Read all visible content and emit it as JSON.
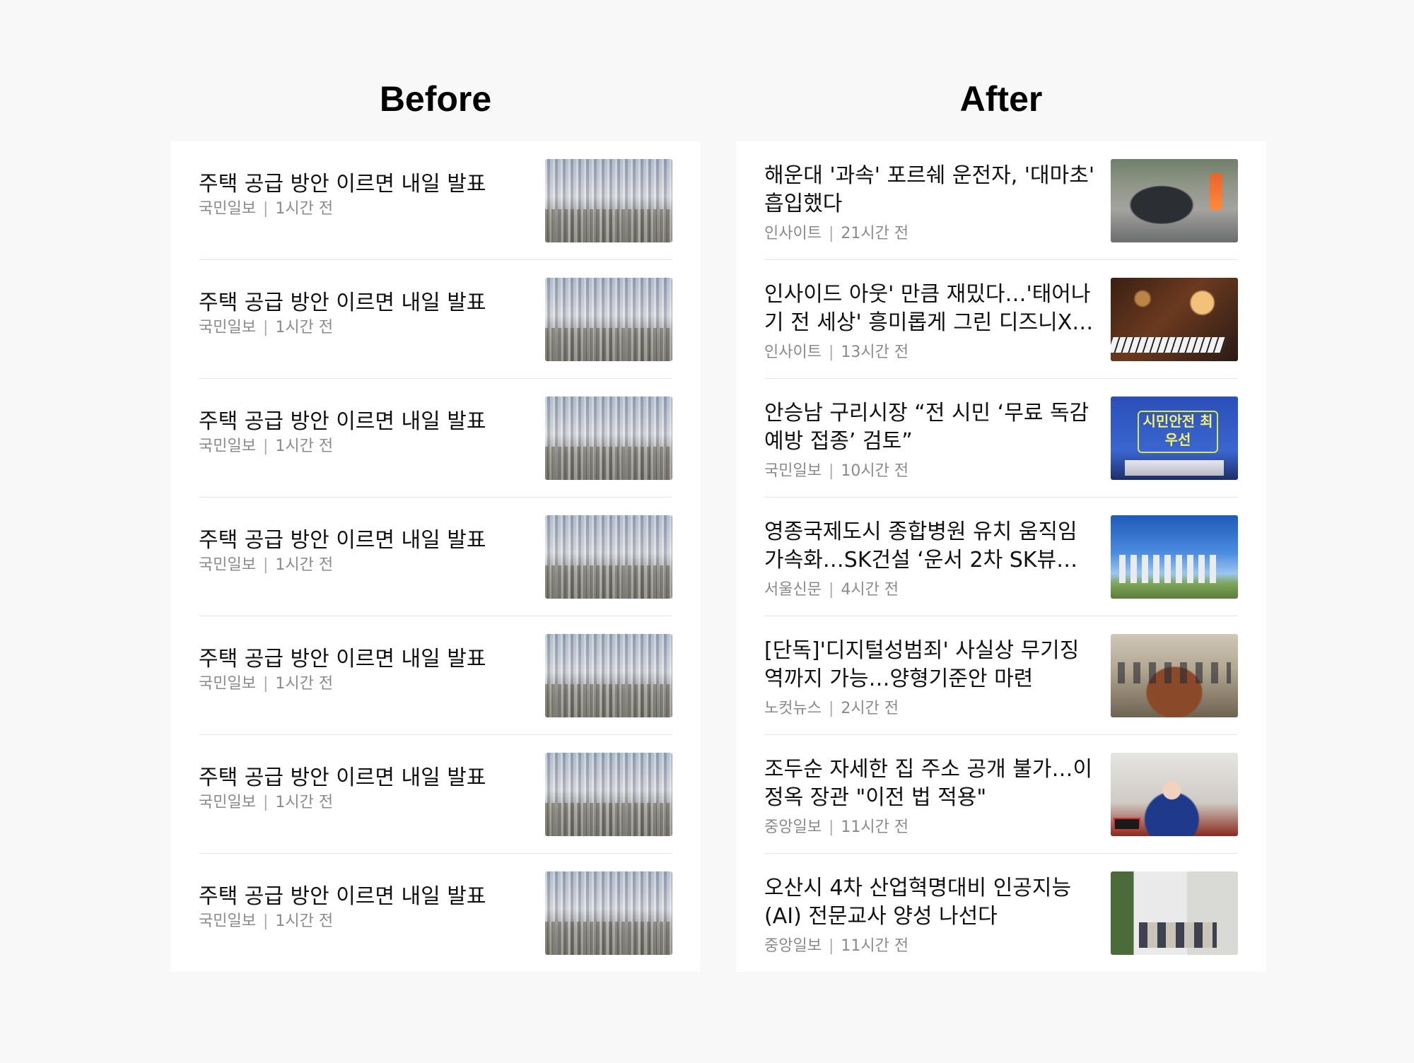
{
  "before": {
    "title": "Before",
    "items": [
      {
        "headline": "주택 공급 방안 이르면 내일 발표",
        "source": "국민일보",
        "time": "1시간 전",
        "thumb_icon": "apartment-city-photo"
      },
      {
        "headline": "주택 공급 방안 이르면 내일 발표",
        "source": "국민일보",
        "time": "1시간 전",
        "thumb_icon": "apartment-city-photo"
      },
      {
        "headline": "주택 공급 방안 이르면 내일 발표",
        "source": "국민일보",
        "time": "1시간 전",
        "thumb_icon": "apartment-city-photo"
      },
      {
        "headline": "주택 공급 방안 이르면 내일 발표",
        "source": "국민일보",
        "time": "1시간 전",
        "thumb_icon": "apartment-city-photo"
      },
      {
        "headline": "주택 공급 방안 이르면 내일 발표",
        "source": "국민일보",
        "time": "1시간 전",
        "thumb_icon": "apartment-city-photo"
      },
      {
        "headline": "주택 공급 방안 이르면 내일 발표",
        "source": "국민일보",
        "time": "1시간 전",
        "thumb_icon": "apartment-city-photo"
      },
      {
        "headline": "주택 공급 방안 이르면 내일 발표",
        "source": "국민일보",
        "time": "1시간 전",
        "thumb_icon": "apartment-city-photo"
      }
    ]
  },
  "after": {
    "title": "After",
    "items": [
      {
        "headline": "해운대 '과속' 포르쉐 운전자, '대마초' 흡입했다",
        "source": "인사이트",
        "time": "21시간 전",
        "thumb_icon": "overturned-car-photo"
      },
      {
        "headline": "인사이드 아웃' 만큼 재밌다…'태어나기 전 세상' 흥미롭게 그린 디즈니X…",
        "source": "인사이트",
        "time": "13시간 전",
        "thumb_icon": "piano-player-photo"
      },
      {
        "headline": "안승남 구리시장 “전 시민 ‘무료 독감 예방 접종’ 검토”",
        "source": "국민일보",
        "time": "10시간 전",
        "thumb_icon": "press-briefing-banner-photo",
        "thumb_text": "시민안전 최우선"
      },
      {
        "headline": "영종국제도시 종합병원 유치 움직임 가속화…SK건설 ‘운서 2차 SK뷰…",
        "source": "서울신문",
        "time": "4시간 전",
        "thumb_icon": "apartment-complex-sky-photo"
      },
      {
        "headline": "[단독]'디지털성범죄' 사실상 무기징역까지 가능…양형기준안 마련",
        "source": "노컷뉴스",
        "time": "2시간 전",
        "thumb_icon": "meeting-room-photo"
      },
      {
        "headline": "조두순 자세한 집 주소 공개 불가…이정옥 장관 \"이전 법 적용\"",
        "source": "중앙일보",
        "time": "11시간 전",
        "thumb_icon": "minister-hearing-photo"
      },
      {
        "headline": "오산시 4차 산업혁명대비 인공지능(AI) 전문교사 양성 나선다",
        "source": "중앙일보",
        "time": "11시간 전",
        "thumb_icon": "office-classroom-photo"
      }
    ]
  },
  "separator": "|"
}
